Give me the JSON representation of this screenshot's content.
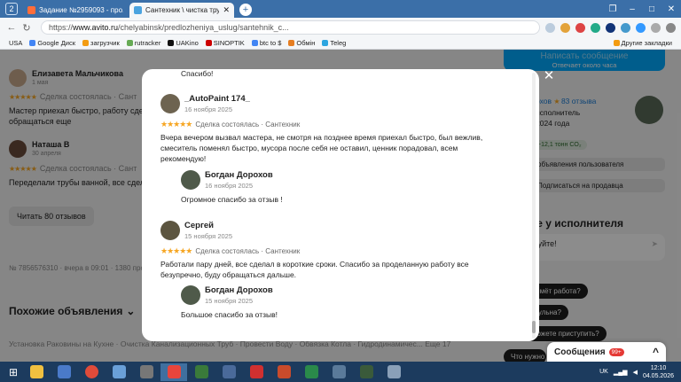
{
  "browser": {
    "tab_count": "2",
    "tabs": [
      {
        "label": "Задание №2959093 - про...",
        "active": false,
        "color": "#ff6d3a"
      },
      {
        "label": "Сантехник \\ чистка тру...",
        "active": true,
        "color": "#4aa3df"
      }
    ],
    "new_tab": "+",
    "url_prefix": "https://",
    "url_host": "www.avito.ru",
    "url_path": "/chelyabinsk/predlozheniya_uslug/santehnik_c...",
    "bookmarks": [
      "USA",
      "Google Диск",
      "загрузчик",
      "rutracker",
      "UAKino",
      "SINOPTIK",
      "btc to $",
      "Обмін",
      "Teleg",
      "Другие закладки"
    ]
  },
  "background": {
    "reviews": [
      {
        "name": "Елизавета Мальчикова",
        "date": "1 мая",
        "meta": "Сделка состоялась · Сант",
        "text1": "Мастер приехал быстро, работу сдел",
        "text2": "обращаться еще"
      },
      {
        "name": "Наташа В",
        "date": "30 апреля",
        "meta": "Сделка состоялась · Сант",
        "text1": "Переделали трубы ванной, все сдела",
        "text2": ""
      }
    ],
    "read_reviews": "Читать 80 отзывов",
    "listing_info": "№ 7856576310 · вчера в 09:01 · 1380 прос",
    "similar_title": "Похожие объявления",
    "similar_chevron": "⌄",
    "similar_links": "Установка Раковины на Кухне · Очистка Канализационных Труб · Провести Воду · Обвязка Котла · Гидродинамичес... Еще 17",
    "right": {
      "contact_button": "Написать сообщение",
      "contact_sub": "Отвечает около часа",
      "rating_prefix": "рхов",
      "rating_reviews": "83 отзыва",
      "role": "исполнитель",
      "since": "2024 года",
      "co2": "−12,1 тонн CO₂",
      "other_ads": "объявления пользователя",
      "subscribe": "Подписаться на продавца",
      "ask_title": "ите у исполнителя",
      "ask_placeholder": "вуйте!",
      "chips": [
        "займёт работа?",
        "гульна?",
        "можете приступить?",
        "Что нужно"
      ]
    }
  },
  "modal": {
    "top_text": "Спасибо!",
    "close": "✕",
    "reviews": [
      {
        "name": "_AutoPaint 174_",
        "date": "16 ноября 2025",
        "stars": "★★★★★",
        "meta": "Сделка состоялась · Сантехник",
        "text": [
          "Вчера вечером вызвал мастера, не смотря на позднее время приехал быстро, был вежлив,",
          "смеситель поменял быстро, мусора после себя не оставил, ценник порадовал, всем",
          "рекомендую!"
        ],
        "reply": {
          "name": "Богдан Дорохов",
          "date": "16 ноября 2025",
          "text": "Огромное спасибо за отзыв !"
        }
      },
      {
        "name": "Сергей",
        "date": "15 ноября 2025",
        "stars": "★★★★★",
        "meta": "Сделка состоялась · Сантехник",
        "text": [
          "Работали пару дней, все сделал в короткие сроки. Спасибо за проделанную работу все",
          "безупречно, буду обращаться дальше."
        ],
        "reply": {
          "name": "Богдан Дорохов",
          "date": "15 ноября 2025",
          "text": "Большое спасибо за отзыв!"
        }
      }
    ]
  },
  "chat": {
    "label": "Сообщения",
    "badge": "99+",
    "chevron": "^"
  },
  "taskbar": {
    "lang": "UK",
    "time": "12:10",
    "date": "04.05.2026"
  }
}
